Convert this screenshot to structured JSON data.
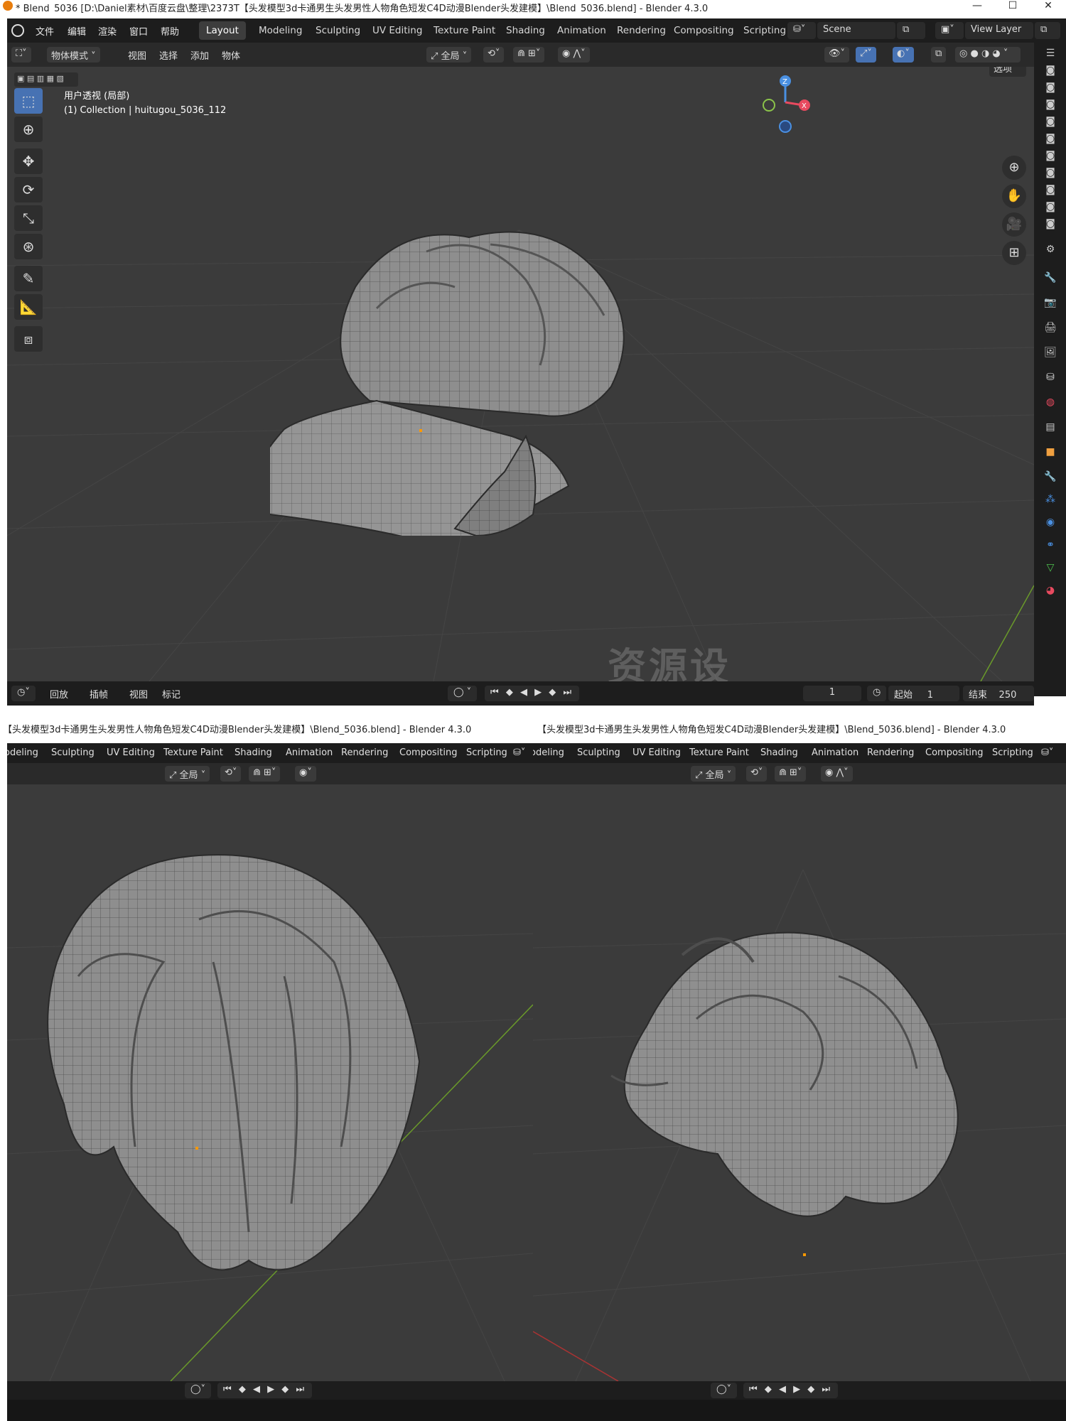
{
  "top_window": {
    "title": "* Blend_5036 [D:\\Daniel素材\\百度云盘\\整理\\2373T【头发模型3d卡通男生头发男性人物角色短发C4D动漫Blender头发建模】\\Blend_5036.blend] - Blender 4.3.0",
    "menu": [
      "文件",
      "编辑",
      "渲染",
      "窗口",
      "帮助"
    ],
    "workspaces": [
      "Layout",
      "Modeling",
      "Sculpting",
      "UV Editing",
      "Texture Paint",
      "Shading",
      "Animation",
      "Rendering",
      "Compositing",
      "Scripting"
    ],
    "active_workspace": "Layout",
    "scene": "Scene",
    "view_layer": "View Layer",
    "header": {
      "mode": "物体模式",
      "menus": [
        "视图",
        "选择",
        "添加",
        "物体"
      ],
      "transform_orientation": "全局",
      "options": "选项"
    },
    "viewport_info": {
      "line1": "用户透视 (局部)",
      "line2": "(1) Collection | huitugou_5036_112"
    },
    "gizmo": {
      "z": "Z",
      "x": "X"
    },
    "timeline": {
      "menus": [
        "回放",
        "插帧",
        "视图",
        "标记"
      ],
      "current_frame": "1",
      "start_label": "起始",
      "start": "1",
      "end_label": "结束",
      "end": "250"
    }
  },
  "bottom_left": {
    "title": "【头发模型3d卡通男生头发男性人物角色短发C4D动漫Blender头发建模】\\Blend_5036.blend] - Blender 4.3.0",
    "workspaces": [
      "odeling",
      "Sculpting",
      "UV Editing",
      "Texture Paint",
      "Shading",
      "Animation",
      "Rendering",
      "Compositing",
      "Scripting"
    ],
    "transform_orientation": "全局"
  },
  "bottom_right": {
    "title": "【头发模型3d卡通男生头发男性人物角色短发C4D动漫Blender头发建模】\\Blend_5036.blend] - Blender 4.3.0",
    "workspaces": [
      "odeling",
      "Sculpting",
      "UV Editing",
      "Texture Paint",
      "Shading",
      "Animation",
      "Rendering",
      "Compositing",
      "Scripting"
    ],
    "transform_orientation": "全局"
  },
  "watermark": "资源设",
  "colors": {
    "active_blue": "#4772b3",
    "x_axis": "#e84a5f",
    "y_axis": "#8bc34a",
    "z_axis": "#4a90e2",
    "origin": "#ff9900"
  }
}
